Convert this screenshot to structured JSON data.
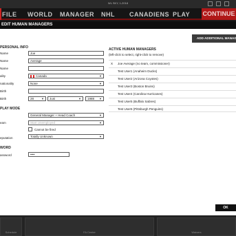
{
  "window": {
    "title": "WL SKY, 1-2018"
  },
  "nav": {
    "items": [
      "FILE",
      "WORLD",
      "MANAGER",
      "NHL",
      "CANADIENS",
      "PLAY"
    ],
    "continue_label": "CONTINUE"
  },
  "dialog": {
    "title": "EDIT HUMAN MANAGERS",
    "add_button": "ADD ADDITIONAL MANAGER",
    "ok_button": "OK"
  },
  "personal": {
    "section": "PERSONAL INFO",
    "first_name_label": "Name",
    "first_name_value": "Joe",
    "last_name_label": "Name",
    "last_name_value": "Average",
    "nickname_label": "Name",
    "nickname_value": "",
    "nationality_label": "ality",
    "nationality_value": "Canada",
    "second_nationality_label": "nationality",
    "second_nationality_value": "None",
    "birth_city_label": "Birth",
    "birth_city_value": "",
    "dob_label": "Birth",
    "dob_day": "28",
    "dob_month": "Juni",
    "dob_year": "1988"
  },
  "game_mode": {
    "section": "PLAY MODE",
    "mode_value": "General Manager + Head Coach",
    "team_label": "eam",
    "team_value": "Start Unemployed",
    "cannot_be_fired_label": "Cannot be fired",
    "reputation_label": "eputation",
    "reputation_value": "Totally Unknown"
  },
  "password": {
    "section": "WORD",
    "label": "assword",
    "value": "••••"
  },
  "active": {
    "section": "ACTIVE HUMAN MANAGERS",
    "subtitle": "(left-click to select, right-click to remove)",
    "managers": [
      {
        "x": "X",
        "name": "Joe Average (no team, commissioner)"
      },
      {
        "x": "",
        "name": "Test User1 (Anaheim Ducks)"
      },
      {
        "x": "",
        "name": "Test User2 (Arizona Coyotes)"
      },
      {
        "x": "",
        "name": "Test User3 (Boston Bruins)"
      },
      {
        "x": "",
        "name": "Test User4 (Carolina Hurricanes)"
      },
      {
        "x": "",
        "name": "Test User5 (Buffalo Sabres)"
      },
      {
        "x": "",
        "name": "Test User6 (Pittsburgh Penguins)"
      }
    ]
  },
  "bottom": {
    "tiles": [
      "Schedule",
      "FA Center",
      "Waivers"
    ]
  },
  "colors": {
    "accent": "#b01818",
    "panel": "#ffffff",
    "nav": "#151515"
  }
}
